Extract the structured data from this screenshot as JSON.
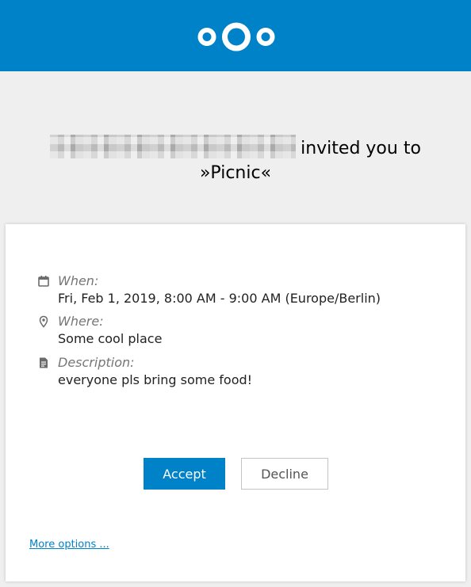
{
  "header": {
    "logo_icon": "nextcloud-logo-icon",
    "brand_color": "#0082c9"
  },
  "invitation": {
    "inviter_redacted": true,
    "invited_text": "invited you to",
    "event_title": "»Picnic«"
  },
  "details": {
    "when": {
      "icon": "calendar-icon",
      "label": "When:",
      "value": "Fri, Feb 1, 2019, 8:00 AM - 9:00 AM (Europe/Berlin)"
    },
    "where": {
      "icon": "location-pin-icon",
      "label": "Where:",
      "value": "Some cool place"
    },
    "description": {
      "icon": "text-document-icon",
      "label": "Description:",
      "value": "everyone pls bring some food!"
    }
  },
  "actions": {
    "accept_label": "Accept",
    "decline_label": "Decline",
    "more_options_label": "More options ..."
  }
}
